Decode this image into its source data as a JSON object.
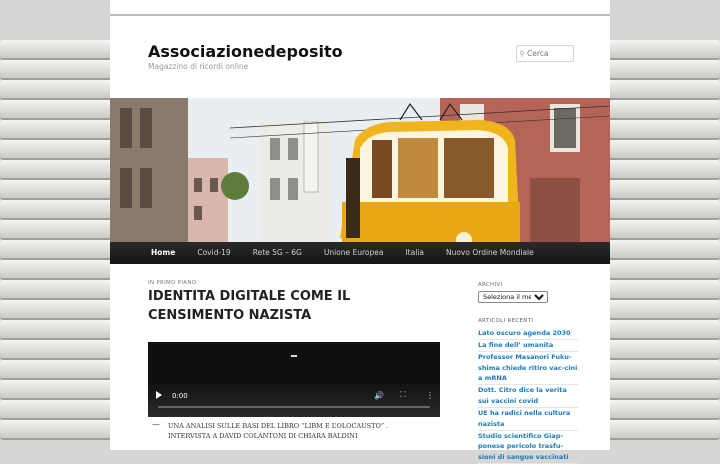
{
  "site": {
    "title": "Associazionedeposito",
    "description": "Magazzino di ricordi online"
  },
  "search": {
    "placeholder": "Cerca",
    "icon": "search-icon"
  },
  "nav": {
    "items": [
      "Home",
      "Covid-19",
      "Rete 5G – 6G",
      "Unione Europea",
      "Italia",
      "Nuovo Ordine Mondiale"
    ]
  },
  "post": {
    "kicker": "IN PRIMO PIANO",
    "title": "IDENTITA DIGITALE COME IL CENSIMENTO NAZISTA",
    "video": {
      "time": "0:00"
    },
    "caption": "UNA ANALISI SULLE BASI DEL LIBRO “LIBM E L’OLOCAUSTO” . INTERVISTA A DAVID COLANTONI DI CHIARA BALDINI"
  },
  "sidebar": {
    "archive_title": "ARCHIVI",
    "archive_selected": "Seleziona il mese",
    "recent_title": "ARTICOLI RECENTI",
    "recent": [
      "Lato oscuro agenda 2030",
      "La fine dell’ umanita",
      "Professor Masanori Fuku-shima chiede ritiro vac-cini a mRNA",
      "Dott. Citro dice la verita sui vaccini covid",
      "UE ha radici nella cultura nazista",
      "Studio scientifico Giap-ponese pericolo trasfu-sioni di sangue vaccinati"
    ]
  },
  "colors": {
    "link": "#1b7bc1",
    "nav_bg": "#1f1f1f",
    "tram_yellow": "#f0b41c"
  }
}
